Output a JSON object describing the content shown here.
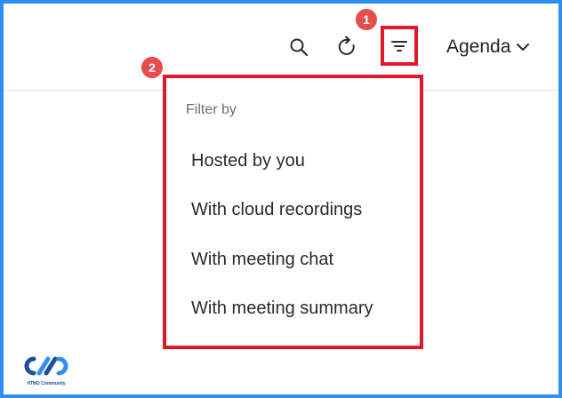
{
  "toolbar": {
    "search_icon": "search-icon",
    "refresh_icon": "refresh-icon",
    "filter_icon": "filter-icon",
    "view_label": "Agenda",
    "view_icon": "chevron-down-icon"
  },
  "annotations": {
    "badge_1": "1",
    "badge_2": "2"
  },
  "filter_menu": {
    "heading": "Filter by",
    "items": [
      {
        "label": "Hosted by you"
      },
      {
        "label": "With cloud recordings"
      },
      {
        "label": "With meeting chat"
      },
      {
        "label": "With meeting summary"
      }
    ]
  },
  "logo": {
    "text": "HTMD Community"
  },
  "colors": {
    "outer_border": "#2f8ff0",
    "highlight": "#e0182d",
    "badge": "#e84c4c"
  }
}
